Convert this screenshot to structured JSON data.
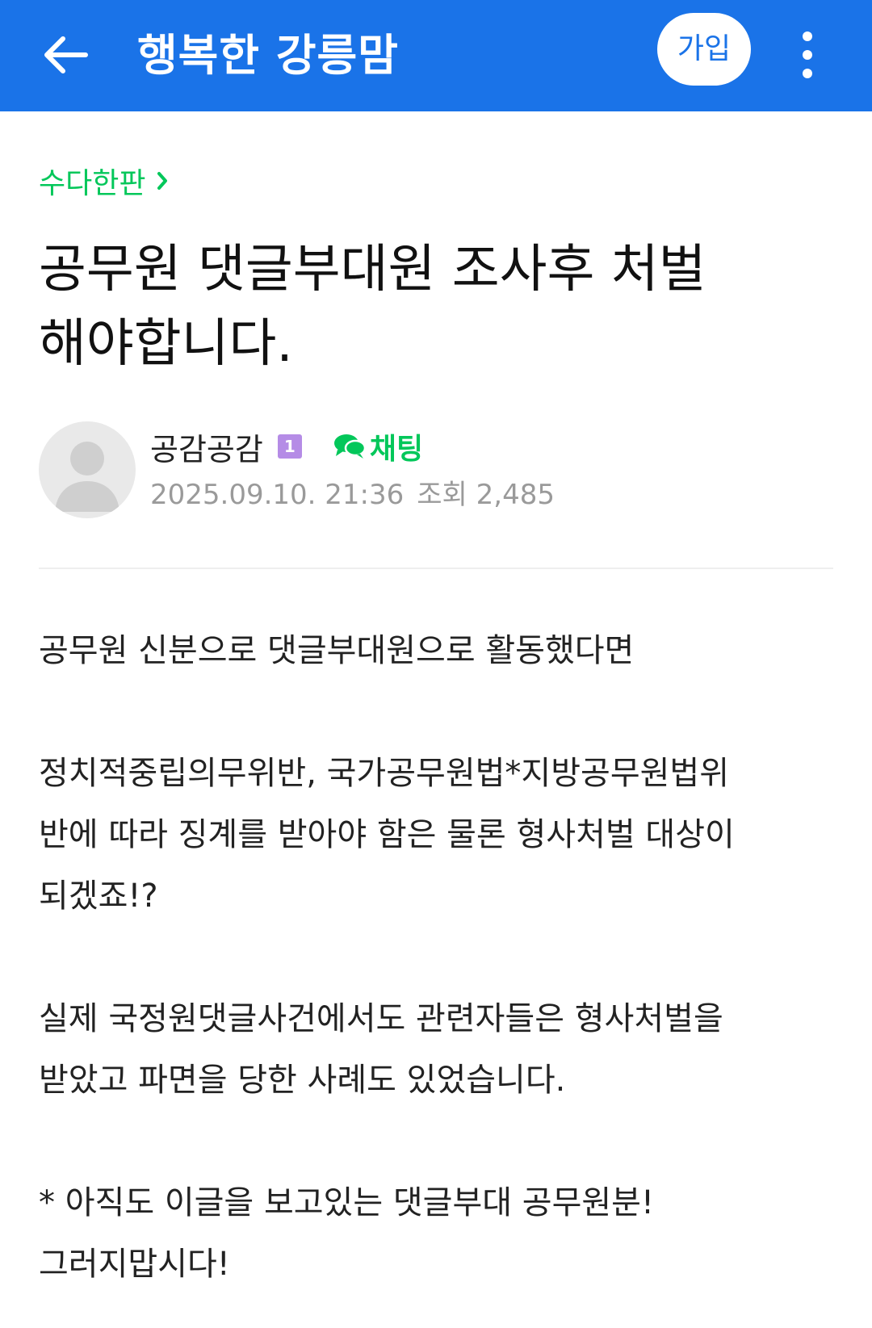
{
  "header": {
    "cafe_name": "행복한 강릉맘",
    "join_label": "가입",
    "back_icon": "back-arrow-icon",
    "more_icon": "more-vertical-icon",
    "background_color": "#1a73e8"
  },
  "post": {
    "board_name": "수다한판",
    "title_line1": "공무원 댓글부대원 조사후 처벌",
    "title_line2": "해야합니다.",
    "author": {
      "name": "공감공감",
      "level": "1",
      "chat_label": "채팅"
    },
    "meta": {
      "date": "2025.09.10. 21:36",
      "views_label": "조회",
      "views": "2,485"
    },
    "body": {
      "p1": "공무원 신분으로 댓글부대원으로 활동했다면",
      "p2_line1": "정치적중립의무위반, 국가공무원법*지방공무원법위",
      "p2_line2": "반에 따라 징계를 받아야 함은 물론 형사처벌 대상이",
      "p2_line3": "되겠죠!?",
      "p3_line1": "실제 국정원댓글사건에서도 관련자들은 형사처벌을",
      "p3_line2": "받았고 파면을 당한 사례도 있었습니다.",
      "p4_line1": "* 아직도 이글을 보고있는 댓글부대 공무원분!",
      "p4_line2": "그러지맙시다!"
    }
  },
  "colors": {
    "accent_green": "#03c75a",
    "badge_purple": "#b58ce6",
    "meta_gray": "#9a9a9a"
  }
}
